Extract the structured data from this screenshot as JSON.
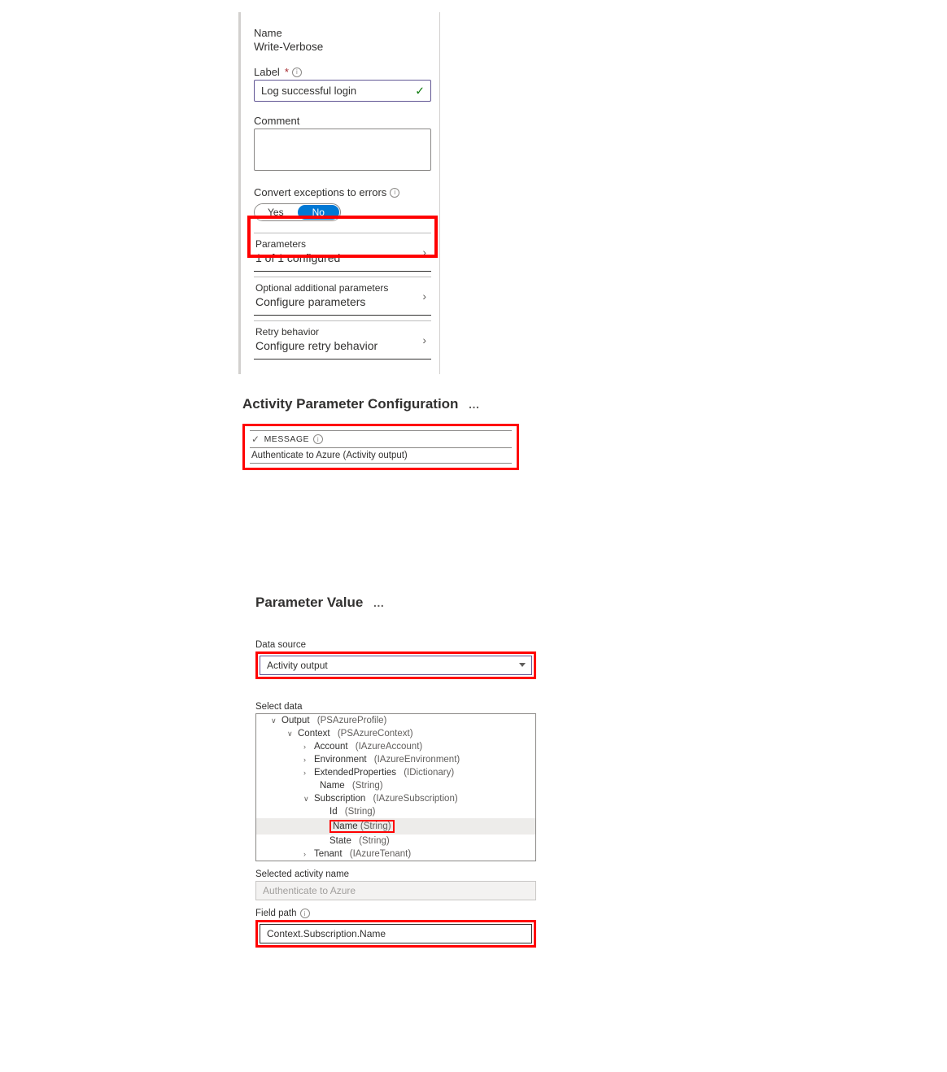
{
  "panel1": {
    "name_label": "Name",
    "name_value": "Write-Verbose",
    "label_label": "Label",
    "label_value": "Log successful login",
    "comment_label": "Comment",
    "comment_value": "",
    "convert_label": "Convert exceptions to errors",
    "toggle_yes": "Yes",
    "toggle_no": "No",
    "params_label": "Parameters",
    "params_sub": "1 of 1 configured",
    "optional_label": "Optional additional parameters",
    "optional_sub": "Configure parameters",
    "retry_label": "Retry behavior",
    "retry_sub": "Configure retry behavior"
  },
  "panel2": {
    "title": "Activity Parameter Configuration",
    "msg_caption": "MESSAGE",
    "msg_value": "Authenticate to Azure (Activity output)"
  },
  "panel3": {
    "title": "Parameter Value",
    "data_source_label": "Data source",
    "data_source_value": "Activity output",
    "select_data_label": "Select data",
    "tree": {
      "n0": "Output",
      "t0": "(PSAzureProfile)",
      "n1": "Context",
      "t1": "(PSAzureContext)",
      "n2": "Account",
      "t2": "(IAzureAccount)",
      "n3": "Environment",
      "t3": "(IAzureEnvironment)",
      "n4": "ExtendedProperties",
      "t4": "(IDictionary)",
      "n5": "Name",
      "t5": "(String)",
      "n6": "Subscription",
      "t6": "(IAzureSubscription)",
      "n7": "Id",
      "t7": "(String)",
      "n8": "Name",
      "t8": "(String)",
      "n9": "State",
      "t9": "(String)",
      "n10": "Tenant",
      "t10": "(IAzureTenant)"
    },
    "selected_activity_label": "Selected activity name",
    "selected_activity_value": "Authenticate to Azure",
    "field_path_label": "Field path",
    "field_path_value": "Context.Subscription.Name"
  }
}
